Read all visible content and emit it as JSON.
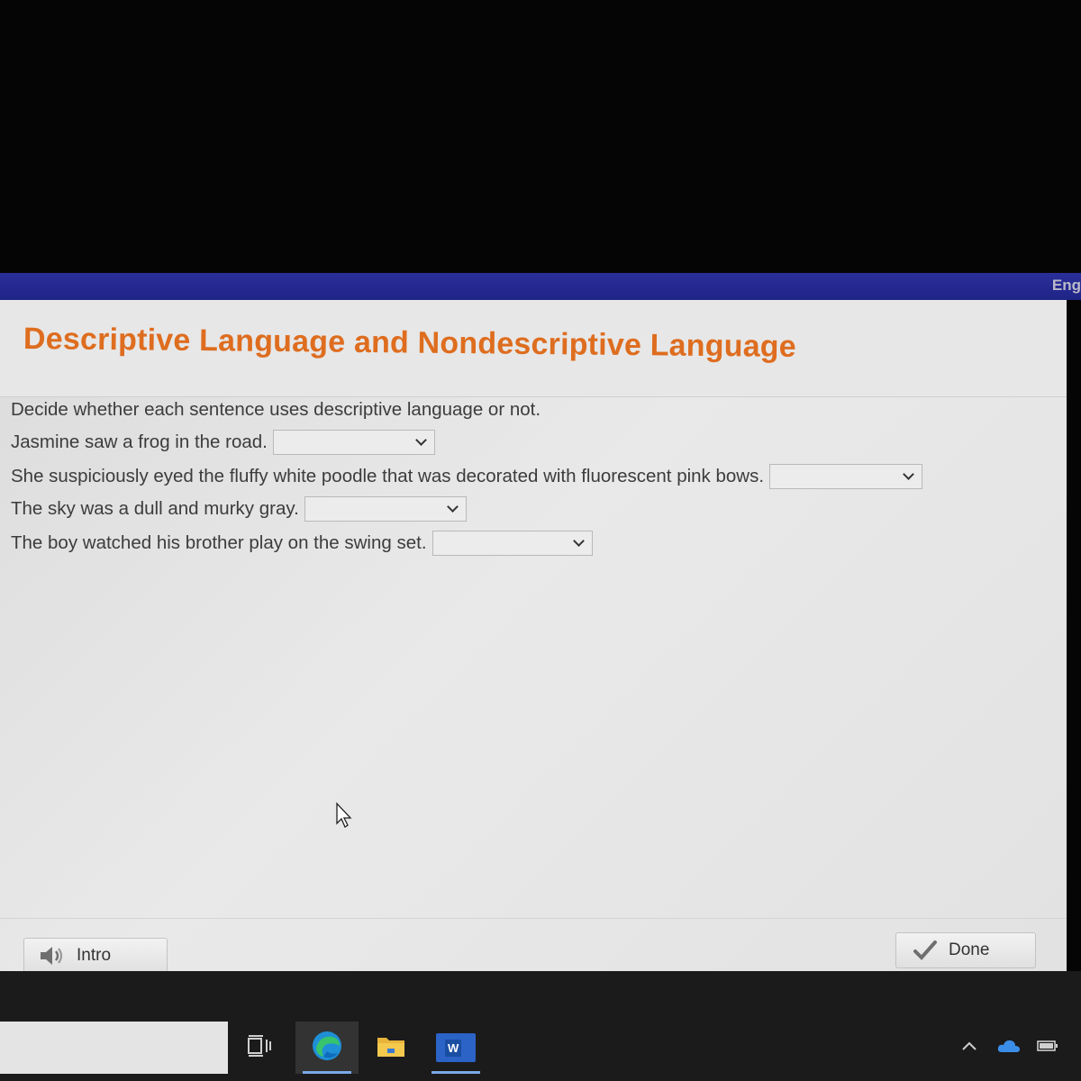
{
  "topbar": {
    "language": "Eng"
  },
  "header": {
    "title": "Descriptive Language and Nondescriptive Language"
  },
  "activity": {
    "instructions": "Decide whether each sentence uses descriptive language or not.",
    "items": [
      {
        "sentence": "Jasmine saw a frog in the road.",
        "selected": ""
      },
      {
        "sentence": "She suspiciously eyed the fluffy white poodle that was decorated with fluorescent pink bows.",
        "selected": ""
      },
      {
        "sentence": "The sky was a dull and murky gray.",
        "selected": ""
      },
      {
        "sentence": "The boy watched his brother play on the swing set.",
        "selected": ""
      }
    ]
  },
  "footer": {
    "intro_label": "Intro",
    "done_label": "Done"
  },
  "taskbar": {
    "word_label": "W"
  },
  "colors": {
    "title": "#de6d1f",
    "topbar": "#2a2f9a",
    "taskbar": "#1b1b1b"
  },
  "icons": [
    "speaker-icon",
    "checkmark-icon",
    "cursor-icon",
    "task-view-icon",
    "edge-icon",
    "file-explorer-icon",
    "word-icon",
    "chevron-up-icon",
    "onedrive-icon",
    "battery-icon"
  ]
}
